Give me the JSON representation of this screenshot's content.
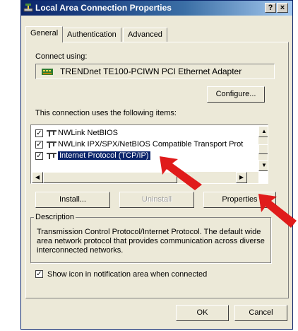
{
  "window": {
    "title": "Local Area Connection Properties",
    "help_label": "?",
    "close_label": "×"
  },
  "tabs": [
    {
      "label": "General",
      "active": true
    },
    {
      "label": "Authentication",
      "active": false
    },
    {
      "label": "Advanced",
      "active": false
    }
  ],
  "connect_using": {
    "label": "Connect using:",
    "adapter": "TRENDnet TE100-PCIWN PCI Ethernet Adapter",
    "configure_label": "Configure..."
  },
  "components": {
    "label": "This connection uses the following items:",
    "items": [
      {
        "label": "NWLink NetBIOS",
        "checked": true,
        "selected": false
      },
      {
        "label": "NWLink IPX/SPX/NetBIOS Compatible Transport Prot",
        "checked": true,
        "selected": false
      },
      {
        "label": "Internet Protocol (TCP/IP)",
        "checked": true,
        "selected": true
      }
    ]
  },
  "buttons": {
    "install": "Install...",
    "uninstall": "Uninstall",
    "properties": "Properties"
  },
  "description": {
    "legend": "Description",
    "text": "Transmission Control Protocol/Internet Protocol. The default wide area network protocol that provides communication across diverse interconnected networks."
  },
  "show_icon": {
    "label": "Show icon in notification area when connected",
    "checked": true
  },
  "footer": {
    "ok": "OK",
    "cancel": "Cancel"
  },
  "colors": {
    "annotation_arrow": "#e01b1b",
    "selection": "#0a246a",
    "dialog_face": "#ece9d8"
  }
}
